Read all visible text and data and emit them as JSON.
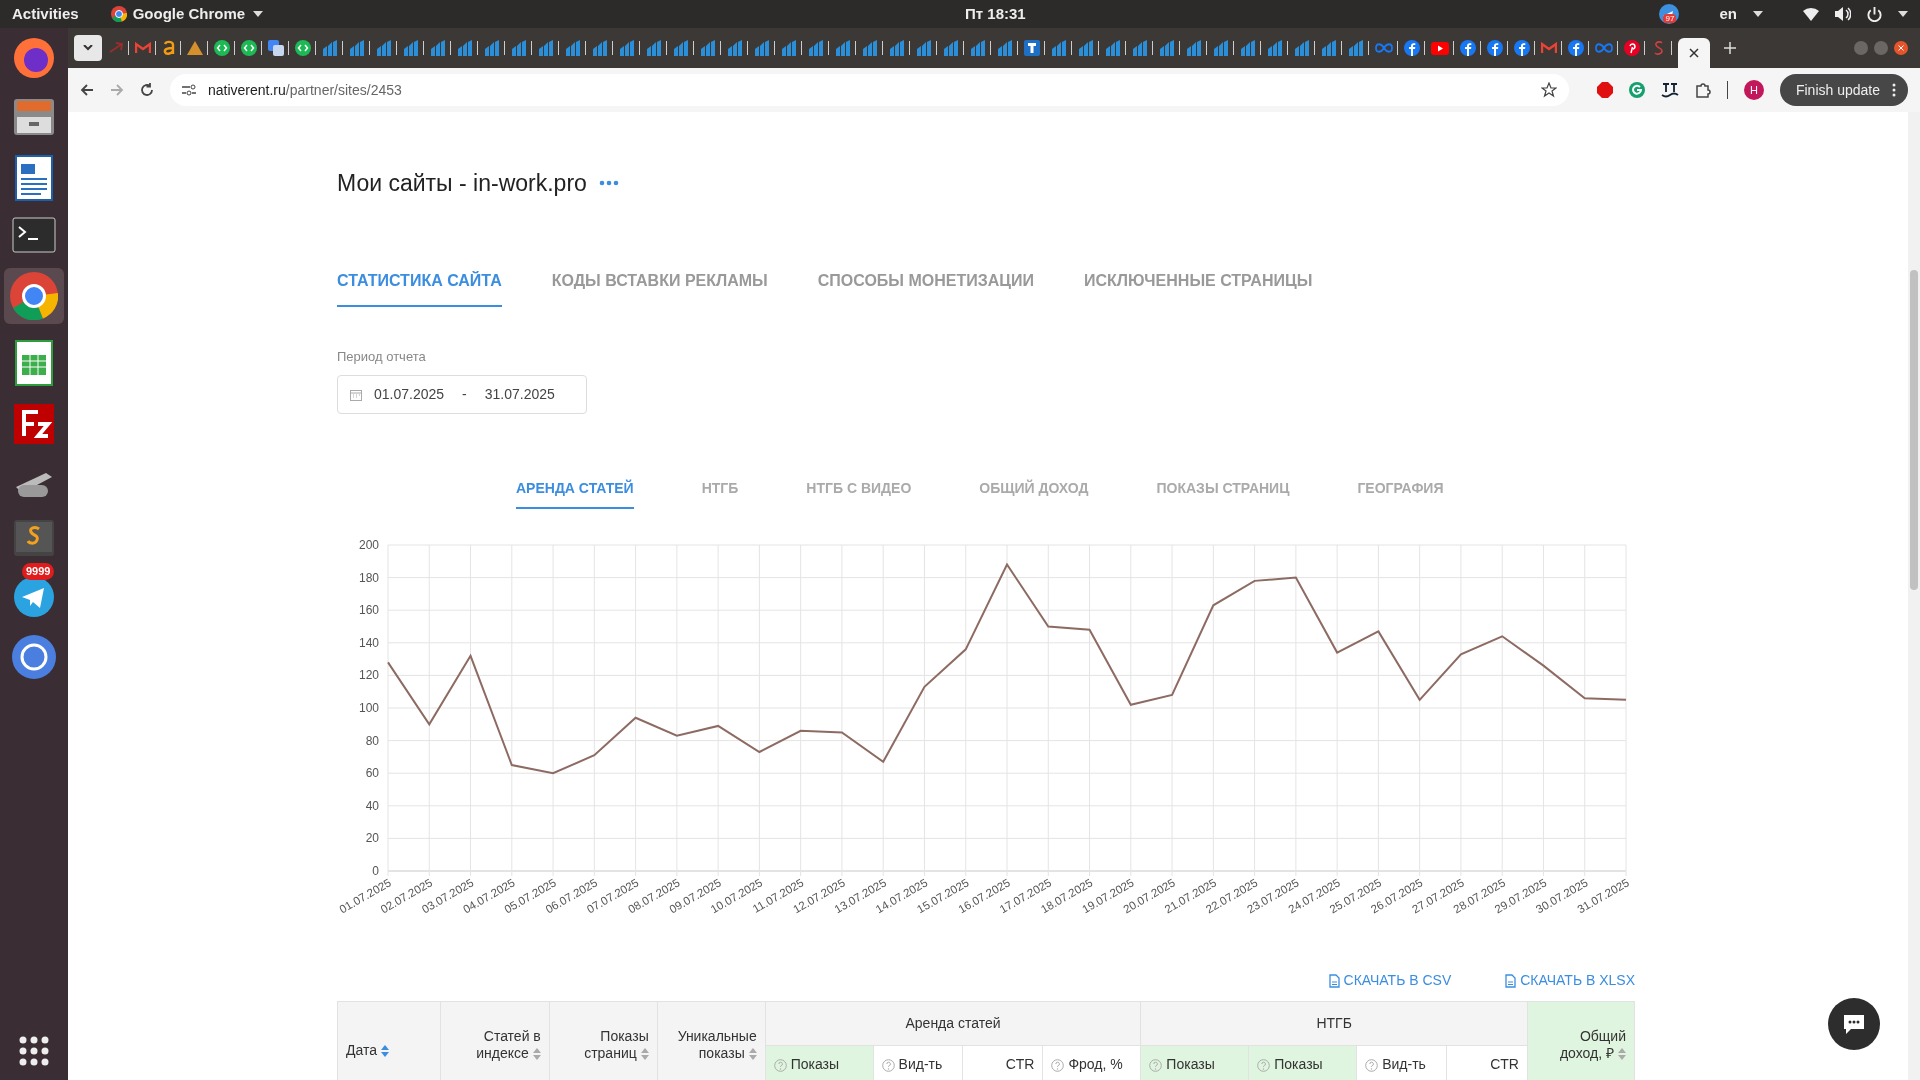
{
  "top_bar": {
    "activities": "Activities",
    "app": "Google Chrome",
    "clock": "Пт 18:31",
    "language": "en",
    "notification_badge": "97"
  },
  "dock": {
    "telegram_badge": "9999"
  },
  "browser": {
    "url_host": "nativerent.ru",
    "url_path": "/partner/sites/2453",
    "finish_update": "Finish update",
    "profile": "H"
  },
  "page": {
    "title": "Мои сайты - in-work.pro",
    "tabs": [
      {
        "label": "СТАТИСТИКА САЙТА",
        "selected": true
      },
      {
        "label": "КОДЫ ВСТАВКИ РЕКЛАМЫ",
        "selected": false
      },
      {
        "label": "СПОСОБЫ МОНЕТИЗАЦИИ",
        "selected": false
      },
      {
        "label": "ИСКЛЮЧЕННЫЕ СТРАНИЦЫ",
        "selected": false
      }
    ],
    "period": {
      "label": "Период отчета",
      "from": "01.07.2025",
      "separator": "-",
      "to": "31.07.2025"
    },
    "chart_tabs": [
      {
        "label": "АРЕНДА СТАТЕЙ",
        "selected": true
      },
      {
        "label": "НТГБ",
        "selected": false
      },
      {
        "label": "НТГБ С ВИДЕО",
        "selected": false
      },
      {
        "label": "ОБЩИЙ ДОХОД",
        "selected": false
      },
      {
        "label": "ПОКАЗЫ СТРАНИЦ",
        "selected": false
      },
      {
        "label": "ГЕОГРАФИЯ",
        "selected": false
      }
    ],
    "chart_data": {
      "type": "line",
      "categories": [
        "01.07.2025",
        "02.07.2025",
        "03.07.2025",
        "04.07.2025",
        "05.07.2025",
        "06.07.2025",
        "07.07.2025",
        "08.07.2025",
        "09.07.2025",
        "10.07.2025",
        "11.07.2025",
        "12.07.2025",
        "13.07.2025",
        "14.07.2025",
        "15.07.2025",
        "16.07.2025",
        "17.07.2025",
        "18.07.2025",
        "19.07.2025",
        "20.07.2025",
        "21.07.2025",
        "22.07.2025",
        "23.07.2025",
        "24.07.2025",
        "25.07.2025",
        "26.07.2025",
        "27.07.2025",
        "28.07.2025",
        "29.07.2025",
        "30.07.2025",
        "31.07.2025"
      ],
      "grid": true,
      "series": [
        {
          "color": "#8d6b63",
          "values": [
            128,
            90,
            132,
            65,
            60,
            71,
            94,
            83,
            89,
            73,
            86,
            85,
            67,
            113,
            136,
            188,
            150,
            148,
            102,
            108,
            163,
            178,
            180,
            134,
            147,
            105,
            133,
            144,
            126,
            106,
            105
          ]
        }
      ],
      "ylim": [
        0,
        200
      ],
      "yticks": [
        0,
        20,
        40,
        60,
        80,
        100,
        120,
        140,
        160,
        180,
        200
      ]
    },
    "downloads": [
      "СКАЧАТЬ В CSV",
      "СКАЧАТЬ В XLSX"
    ],
    "table": {
      "columns": [
        {
          "label": "Дата",
          "sorted": true
        },
        {
          "label": "Статей в индексе",
          "sorted": false
        },
        {
          "label": "Показы страниц",
          "sorted": false
        },
        {
          "label": "Уникальные показы",
          "sorted": false
        }
      ],
      "groups": [
        {
          "label": "Аренда статей",
          "subcolumns": [
            {
              "label": "Показы",
              "highlighted": true,
              "help": true
            },
            {
              "label": "Вид-ть",
              "highlighted": false,
              "help": true
            },
            {
              "label": "CTR",
              "highlighted": false,
              "help": false
            },
            {
              "label": "Фрод, %",
              "highlighted": false,
              "help": true
            }
          ]
        },
        {
          "label": "НТГБ",
          "subcolumns": [
            {
              "label": "Показы",
              "highlighted": true,
              "help": true
            },
            {
              "label": "Показы",
              "highlighted": true,
              "help": true
            },
            {
              "label": "Вид-ть",
              "highlighted": false,
              "help": true
            },
            {
              "label": "CTR",
              "highlighted": false,
              "help": false
            }
          ]
        }
      ],
      "total": {
        "label": "Общий доход, ₽"
      }
    }
  }
}
